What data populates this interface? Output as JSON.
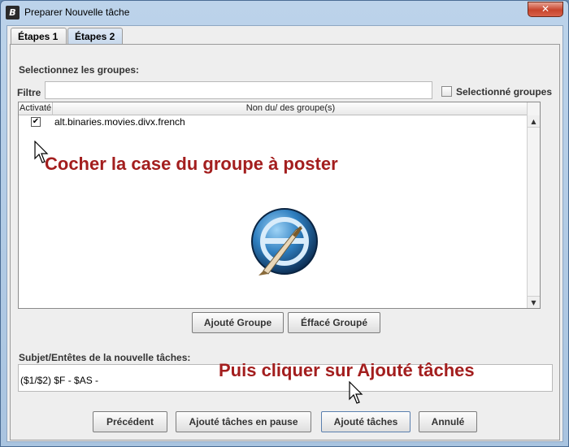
{
  "window": {
    "title": "Preparer Nouvelle tâche",
    "app_icon": "app-icon",
    "close_label": "✕"
  },
  "tabs": [
    {
      "label": "Étapes 1"
    },
    {
      "label": "Étapes 2",
      "selected": true
    }
  ],
  "groups": {
    "heading": "Selectionnez les groupes:",
    "filter_label": "Filtre",
    "filter_value": "",
    "selected_groups_label": "Selectionné groupes",
    "selected_groups_checked": false,
    "columns": [
      "Activaté",
      "Non du/ des groupe(s)"
    ],
    "rows": [
      {
        "checked": true,
        "check_mark": "✔",
        "name": "alt.binaries.movies.divx.french"
      }
    ]
  },
  "annotations": {
    "step1": "Cocher la case du groupe à poster",
    "step2": "Puis cliquer sur Ajouté tâches"
  },
  "group_buttons": {
    "add": "Ajouté Groupe",
    "delete": "Éffacé Groupé"
  },
  "subject": {
    "label": "Subjet/Entêtes de la nouvelle tâches:",
    "value": "($1/$2) $F - $AS -"
  },
  "footer_buttons": {
    "previous": "Précédent",
    "add_paused": "Ajouté tâches en pause",
    "add_tasks": "Ajouté tâches",
    "cancel": "Annulé"
  },
  "colors": {
    "annotation": "#a31e1e",
    "title_bar": "#bcd3ea",
    "close_button": "#c7442c"
  }
}
